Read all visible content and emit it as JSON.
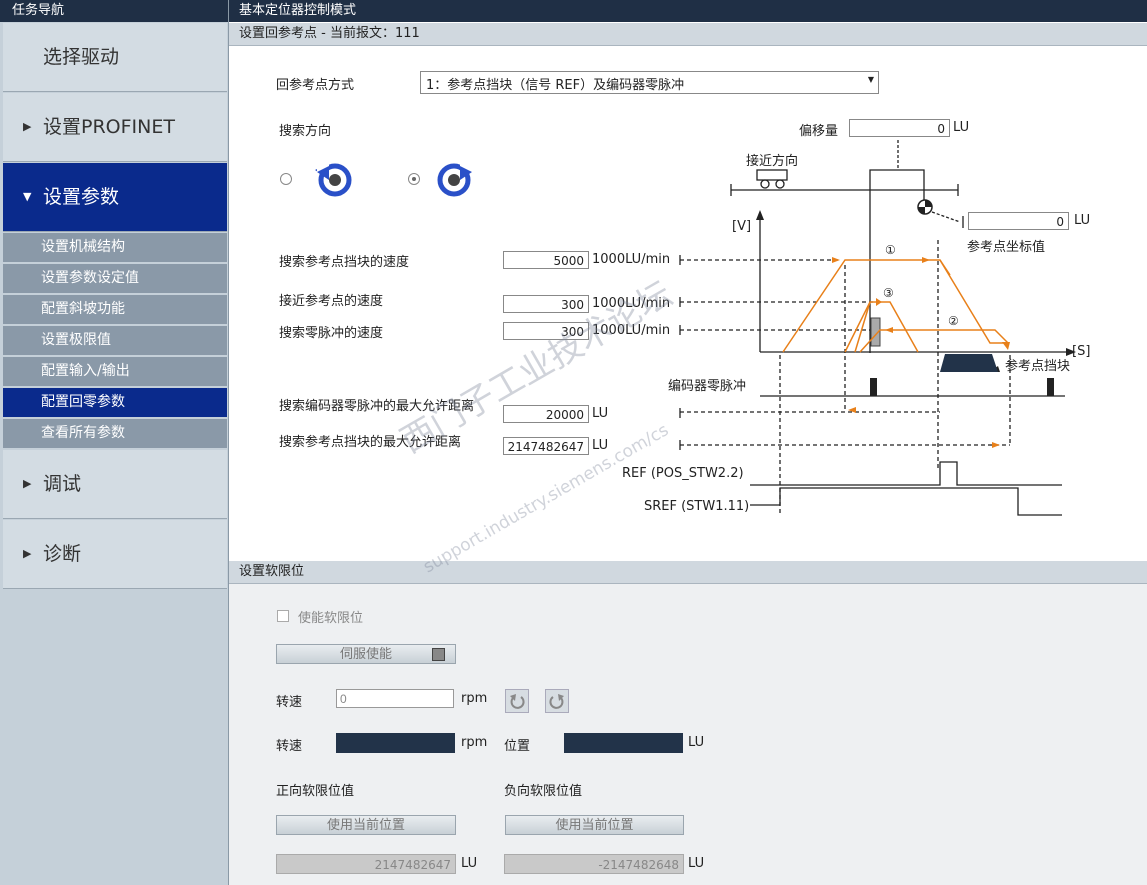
{
  "sidebar": {
    "title": "任务导航",
    "main_items": [
      {
        "label": "选择驱动",
        "arrow": ""
      },
      {
        "label": "设置PROFINET",
        "arrow": "▶"
      },
      {
        "label": "设置参数",
        "arrow": "▼"
      },
      {
        "label": "调试",
        "arrow": "▶"
      },
      {
        "label": "诊断",
        "arrow": "▶"
      }
    ],
    "sub_items": [
      "设置机械结构",
      "设置参数设定值",
      "配置斜坡功能",
      "设置极限值",
      "配置输入/输出",
      "配置回零参数",
      "查看所有参数"
    ]
  },
  "header": {
    "title": "基本定位器控制模式"
  },
  "homing": {
    "section_title": "设置回参考点 - 当前报文：111",
    "mode_label": "回参考点方式",
    "mode_value": "1：参考点挡块（信号 REF）及编码器零脉冲",
    "direction_label": "搜索方向",
    "offset_label": "偏移量",
    "offset_value": "0",
    "offset_unit": "LU",
    "approach_dir_label": "接近方向",
    "ref_coord_value": "0",
    "ref_coord_unit": "LU",
    "ref_coord_label": "参考点坐标值",
    "speed_search_cam_label": "搜索参考点挡块的速度",
    "speed_search_cam_value": "5000",
    "speed_approach_label": "接近参考点的速度",
    "speed_approach_value": "300",
    "speed_zero_label": "搜索零脉冲的速度",
    "speed_zero_value": "300",
    "speed_unit": "1000LU/min",
    "max_enc_label": "搜索编码器零脉冲的最大允许距离",
    "max_enc_value": "20000",
    "max_cam_label": "搜索参考点挡块的最大允许距离",
    "max_cam_value": "2147482647",
    "dist_unit": "LU",
    "diagram": {
      "v_axis": "[V]",
      "s_axis": "[S]",
      "cam_label": "参考点挡块",
      "encoder_label": "编码器零脉冲",
      "ref_signal": "REF (POS_STW2.2)",
      "sref_signal": "SREF (STW1.11)",
      "marker1": "①",
      "marker2": "②",
      "marker3": "③",
      "orange": "#e8801a"
    }
  },
  "softlimit": {
    "section_title": "设置软限位",
    "enable_label": "使能软限位",
    "servo_btn": "伺服使能",
    "speed_label": "转速",
    "speed_input": "0",
    "rpm": "rpm",
    "speed2_label": "转速",
    "pos_label": "位置",
    "lu": "LU",
    "pos_limit_label": "正向软限位值",
    "neg_limit_label": "负向软限位值",
    "use_current_pos": "使用当前位置",
    "pos_limit_value": "2147482647",
    "neg_limit_value": "-2147482648"
  },
  "watermark": "西门子工业技术论坛",
  "watermark_url": "support.industry.siemens.com/cs"
}
